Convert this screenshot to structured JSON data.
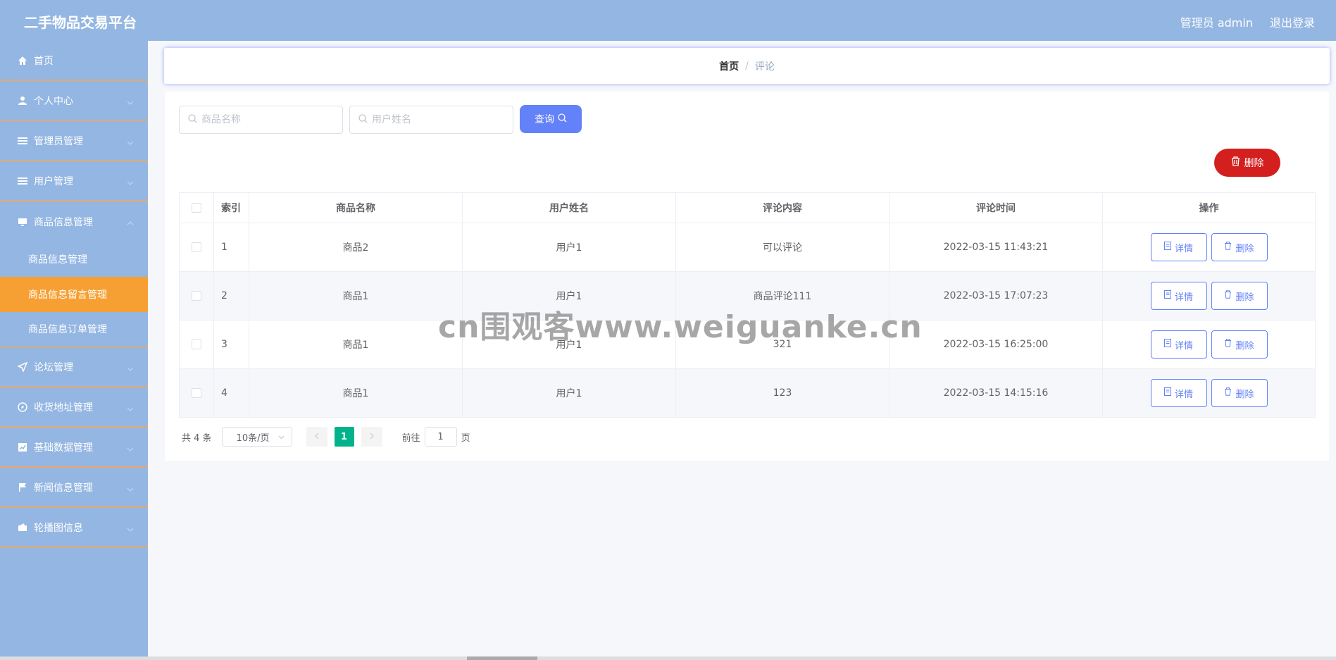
{
  "header": {
    "app_title": "二手物品交易平台",
    "user_label": "管理员 admin",
    "logout_label": "退出登录"
  },
  "sidebar": {
    "items": [
      {
        "label": "首页",
        "icon": "home-icon"
      },
      {
        "label": "个人中心",
        "icon": "user-icon"
      },
      {
        "label": "管理员管理",
        "icon": "menu-icon"
      },
      {
        "label": "用户管理",
        "icon": "menu-icon"
      },
      {
        "label": "商品信息管理",
        "icon": "monitor-icon"
      },
      {
        "label": "论坛管理",
        "icon": "send-icon"
      },
      {
        "label": "收货地址管理",
        "icon": "compass-icon"
      },
      {
        "label": "基础数据管理",
        "icon": "chart-icon"
      },
      {
        "label": "新闻信息管理",
        "icon": "flag-icon"
      },
      {
        "label": "轮播图信息",
        "icon": "wallet-icon"
      }
    ],
    "sub_items": [
      {
        "label": "商品信息管理"
      },
      {
        "label": "商品信息留言管理"
      },
      {
        "label": "商品信息订单管理"
      }
    ]
  },
  "breadcrumb": {
    "home": "首页",
    "separator": "/",
    "current": "评论"
  },
  "search": {
    "product_placeholder": "商品名称",
    "user_placeholder": "用户姓名",
    "query_label": "查询"
  },
  "toolbar": {
    "delete_label": "删除"
  },
  "table": {
    "headers": [
      "索引",
      "商品名称",
      "用户姓名",
      "评论内容",
      "评论时间",
      "操作"
    ],
    "rows": [
      {
        "index": "1",
        "product": "商品2",
        "user": "用户1",
        "content": "可以评论",
        "time": "2022-03-15 11:43:21"
      },
      {
        "index": "2",
        "product": "商品1",
        "user": "用户1",
        "content": "商品评论111",
        "time": "2022-03-15 17:07:23"
      },
      {
        "index": "3",
        "product": "商品1",
        "user": "用户1",
        "content": "321",
        "time": "2022-03-15 16:25:00"
      },
      {
        "index": "4",
        "product": "商品1",
        "user": "用户1",
        "content": "123",
        "time": "2022-03-15 14:15:16"
      }
    ],
    "detail_label": "详情",
    "delete_label": "删除"
  },
  "pagination": {
    "total_text": "共 4 条",
    "page_size": "10条/页",
    "current_page": "1",
    "goto_prefix": "前往",
    "goto_value": "1",
    "goto_suffix": "页"
  },
  "watermark": "cn围观客www.weiguanke.cn",
  "colors": {
    "header_bg": "#94b6e2",
    "sidebar_bg": "#94b6e2",
    "active_item": "#f6a033",
    "primary": "#6381f8",
    "danger": "#d41f1f",
    "page_active": "#00b38a"
  }
}
